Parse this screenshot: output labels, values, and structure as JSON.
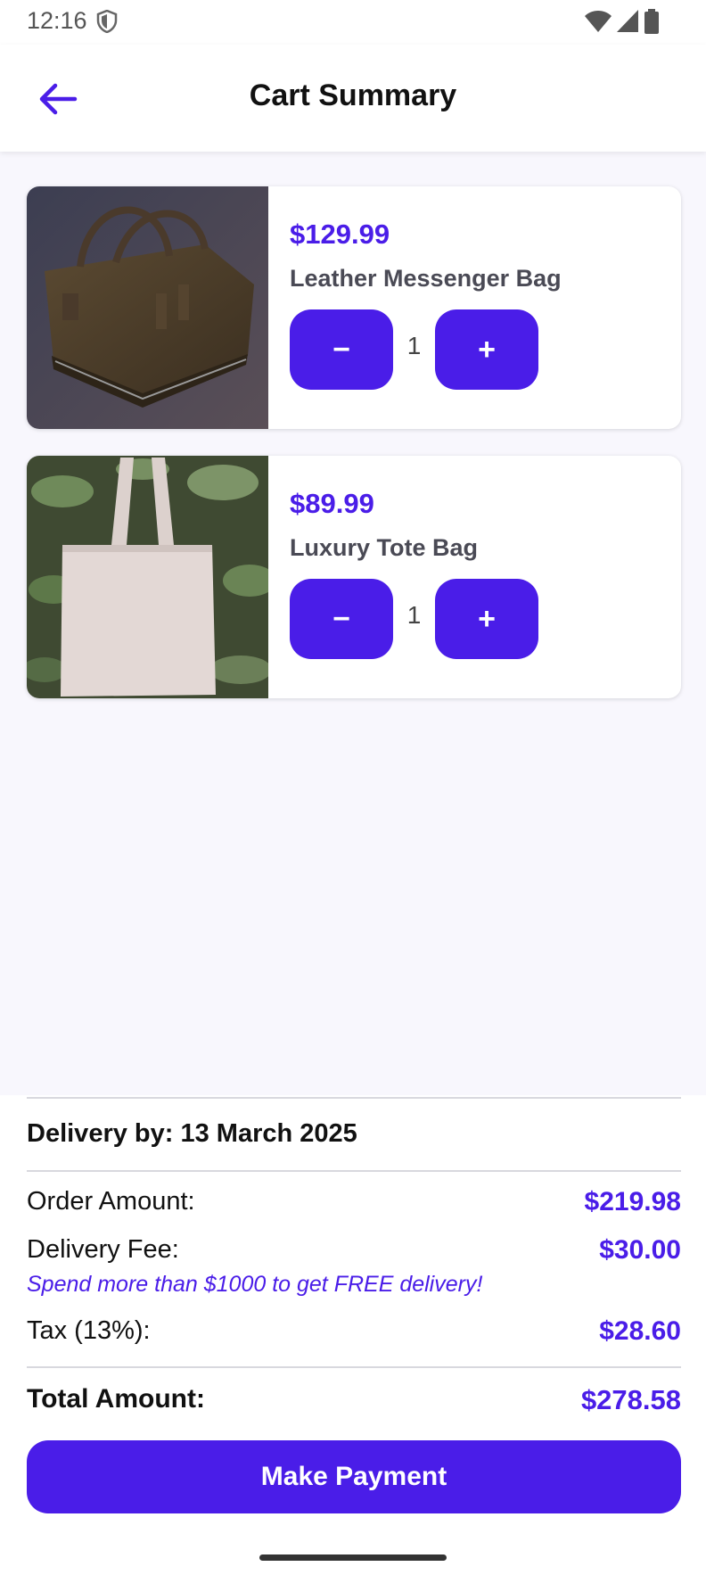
{
  "status_bar": {
    "time": "12:16"
  },
  "header": {
    "title": "Cart Summary"
  },
  "cart": {
    "items": [
      {
        "price": "$129.99",
        "name": "Leather Messenger Bag",
        "quantity": "1",
        "minus_label": "−",
        "plus_label": "+"
      },
      {
        "price": "$89.99",
        "name": "Luxury Tote Bag",
        "quantity": "1",
        "minus_label": "−",
        "plus_label": "+"
      }
    ]
  },
  "summary": {
    "delivery_by": "Delivery by: 13 March 2025",
    "order_amount_label": "Order Amount:",
    "order_amount_value": "$219.98",
    "delivery_fee_label": "Delivery Fee:",
    "delivery_fee_value": "$30.00",
    "promo_text": "Spend more than $1000 to get FREE delivery!",
    "tax_label": "Tax (13%):",
    "tax_value": "$28.60",
    "total_label": "Total Amount:",
    "total_value": "$278.58",
    "pay_button_label": "Make Payment"
  },
  "colors": {
    "accent": "#4a1de8",
    "background": "#f8f7fd"
  },
  "icons": [
    "back-arrow-icon",
    "shield-icon",
    "wifi-icon",
    "signal-icon",
    "battery-icon"
  ]
}
